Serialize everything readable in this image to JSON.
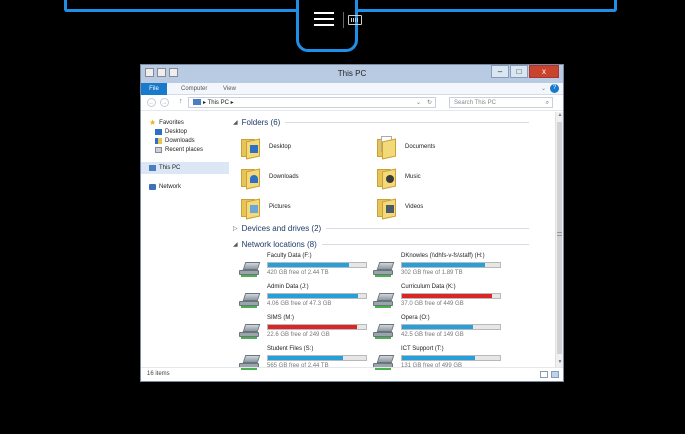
{
  "remote_bar": {
    "menu_icon": "hamburger-icon",
    "keyboard_icon": "keyboard-icon"
  },
  "window": {
    "title": "This PC",
    "controls": {
      "minimize": "–",
      "maximize": "□",
      "close": "x"
    },
    "ribbon": {
      "file_tab": "File",
      "tabs": [
        "Computer",
        "View"
      ],
      "expand": "⌄",
      "help": "?"
    },
    "address": {
      "crumb_sep": "▸",
      "location": "This PC",
      "refresh": "↻",
      "dropdown": "⌄",
      "back": "←",
      "forward": "→",
      "up": "↑"
    },
    "search": {
      "placeholder": "Search This PC",
      "icon": "⌕"
    },
    "nav": {
      "favorites": "Favorites",
      "favorite_items": [
        "Desktop",
        "Downloads",
        "Recent places"
      ],
      "this_pc": "This PC",
      "network": "Network"
    },
    "groups": {
      "folders": "Folders (6)",
      "devices": "Devices and drives (2)",
      "network": "Network locations (8)"
    },
    "folders": [
      "Desktop",
      "Documents",
      "Downloads",
      "Music",
      "Pictures",
      "Videos"
    ],
    "drives": [
      {
        "name": "Faculty Data (F:)",
        "free": "420 GB free of 2.44 TB",
        "used_fraction": 0.83,
        "status": "normal"
      },
      {
        "name": "DKnowles (\\\\dhfs-v-fs\\staff) (H:)",
        "free": "302 GB free of 1.89 TB",
        "used_fraction": 0.85,
        "status": "normal"
      },
      {
        "name": "Admin Data (J:)",
        "free": "4.06 GB free of 47.3 GB",
        "used_fraction": 0.92,
        "status": "normal"
      },
      {
        "name": "Curriculum Data (K:)",
        "free": "37.0 GB free of 449 GB",
        "used_fraction": 0.92,
        "status": "critical"
      },
      {
        "name": "SIMS (M:)",
        "free": "22.6 GB free of 249 GB",
        "used_fraction": 0.91,
        "status": "critical"
      },
      {
        "name": "Opera (O:)",
        "free": "42.5 GB free of 149 GB",
        "used_fraction": 0.72,
        "status": "normal"
      },
      {
        "name": "Student Files (S:)",
        "free": "565 GB free of 2.44 TB",
        "used_fraction": 0.77,
        "status": "normal"
      },
      {
        "name": "ICT Support (T:)",
        "free": "131 GB free of 499 GB",
        "used_fraction": 0.74,
        "status": "normal"
      }
    ],
    "status": {
      "items": "16 items"
    },
    "colors": {
      "accent": "#1e90e8",
      "bar_normal": "#26a0da",
      "bar_critical": "#da2626"
    }
  }
}
